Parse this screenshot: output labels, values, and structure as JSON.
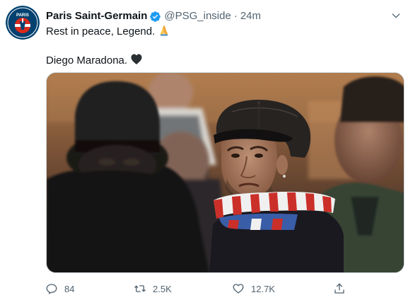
{
  "author": {
    "name": "Paris Saint-Germain",
    "handle": "@PSG_inside",
    "separator": "·",
    "time": "24m",
    "avatar_text": "PARIS"
  },
  "tweet": {
    "line1": "Rest in peace, Legend.",
    "line2": "Diego Maradona."
  },
  "actions": {
    "replies": "84",
    "retweets": "2.5K",
    "likes": "12.7K"
  },
  "icons": {
    "verified": "verified-badge-icon",
    "more": "chevron-down-icon",
    "emoji1": "folded-hands-emoji",
    "emoji2": "black-heart-emoji",
    "reply": "reply-icon",
    "retweet": "retweet-icon",
    "like": "heart-icon",
    "share": "share-icon"
  },
  "colors": {
    "verified_blue": "#1d9bf0",
    "psg_navy": "#004170",
    "psg_red": "#da291c",
    "muted_text": "#536471"
  }
}
